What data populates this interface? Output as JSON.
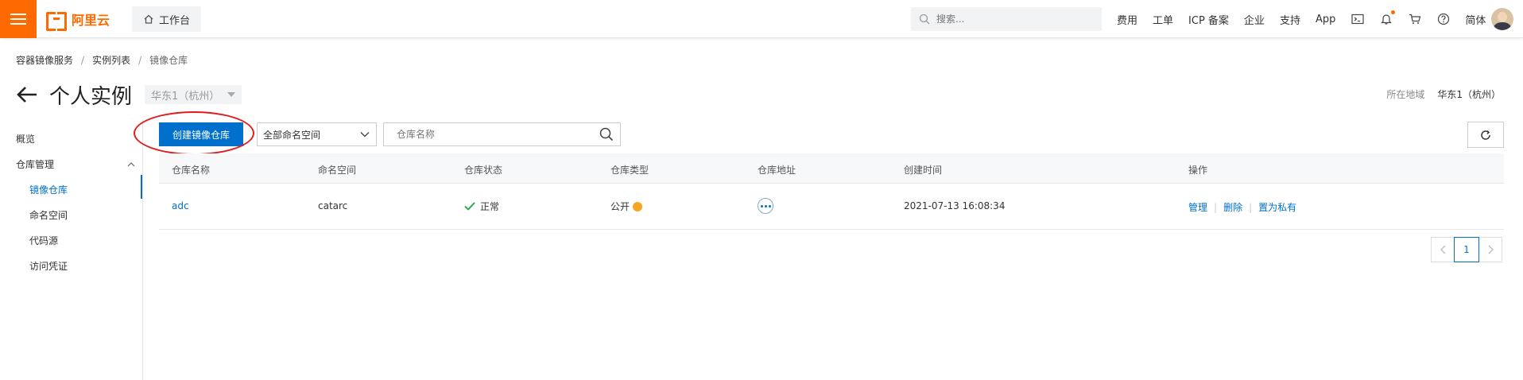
{
  "topbar": {
    "logo_text": "阿里云",
    "workbench_label": "工作台",
    "search_placeholder": "搜索...",
    "links": [
      "费用",
      "工单",
      "ICP 备案",
      "企业",
      "支持",
      "App"
    ],
    "lang_label": "简体",
    "brand_color": "#ff6a00"
  },
  "breadcrumb": {
    "items": [
      "容器镜像服务",
      "实例列表",
      "镜像仓库"
    ]
  },
  "header": {
    "title": "个人实例",
    "region_select": "华东1（杭州）",
    "region_label": "所在地域",
    "region_value": "华东1（杭州）"
  },
  "sidebar": {
    "overview": "概览",
    "repo_mgmt": "仓库管理",
    "items": [
      "镜像仓库",
      "命名空间",
      "代码源",
      "访问凭证"
    ],
    "active_index": 0
  },
  "toolbar": {
    "create_label": "创建镜像仓库",
    "namespace_select": "全部命名空间",
    "name_search_placeholder": "仓库名称"
  },
  "table": {
    "columns": [
      "仓库名称",
      "命名空间",
      "仓库状态",
      "仓库类型",
      "仓库地址",
      "创建时间",
      "操作"
    ],
    "rows": [
      {
        "name": "adc",
        "namespace": "catarc",
        "status": "正常",
        "type": "公开",
        "created": "2021-07-13 16:08:34",
        "actions": [
          "管理",
          "删除",
          "置为私有"
        ]
      }
    ]
  },
  "pagination": {
    "current_page": "1"
  },
  "colors": {
    "primary": "#0070cc",
    "success": "#1ca44a",
    "warning": "#f5a623",
    "annotation": "#e21c1c"
  }
}
